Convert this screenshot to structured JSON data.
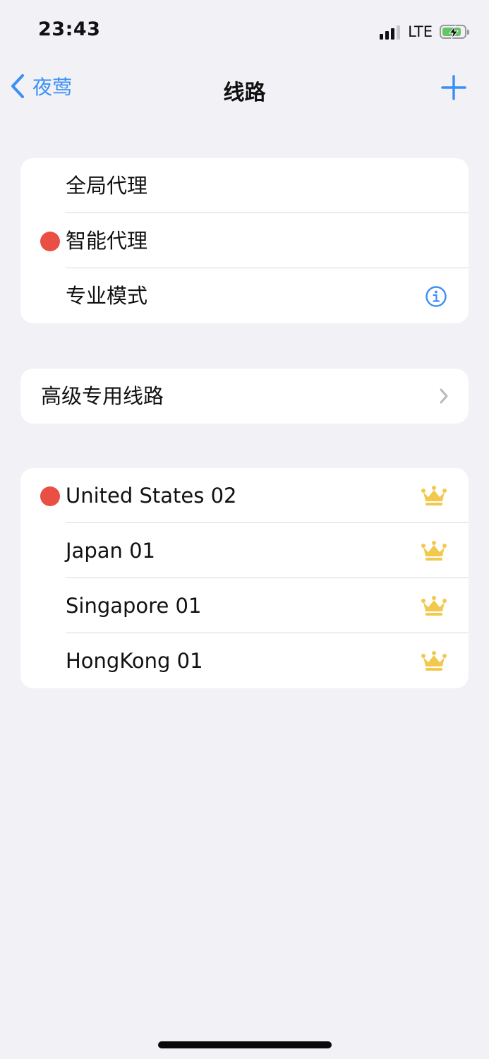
{
  "status_bar": {
    "time": "23:43",
    "network": "LTE",
    "battery_level": 0.85,
    "battery_charging": true
  },
  "nav": {
    "back_label": "夜莺",
    "title": "线路",
    "accent_color": "#3a8ff5"
  },
  "mode_group": {
    "items": [
      {
        "label": "全局代理",
        "selected": false
      },
      {
        "label": "智能代理",
        "selected": true
      },
      {
        "label": "专业模式",
        "selected": false,
        "icon": "info-icon"
      }
    ]
  },
  "premium_group": {
    "label": "高级专用线路",
    "icon": "chevron-right-icon"
  },
  "servers_group": {
    "items": [
      {
        "label": "United States 02",
        "selected": true,
        "icon": "crown-icon"
      },
      {
        "label": "Japan 01",
        "selected": false,
        "icon": "crown-icon"
      },
      {
        "label": "Singapore 01",
        "selected": false,
        "icon": "crown-icon"
      },
      {
        "label": "HongKong 01",
        "selected": false,
        "icon": "crown-icon"
      }
    ]
  },
  "colors": {
    "background": "#f1f1f6",
    "selected_dot": "#ea4f43",
    "crown": "#f2c94c",
    "battery": "#65c466"
  }
}
